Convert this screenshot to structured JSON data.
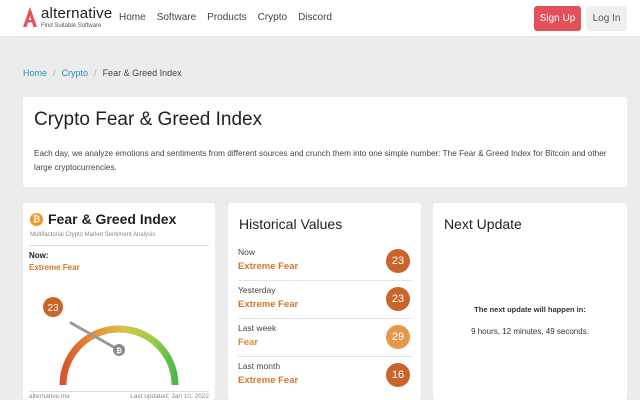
{
  "nav": {
    "logo": {
      "name": "alternative",
      "tagline": "Find Suitable Software"
    },
    "menu": [
      "Home",
      "Software",
      "Products",
      "Crypto",
      "Discord"
    ],
    "signup": "Sign Up",
    "login": "Log In",
    "accent": "#e4505a"
  },
  "breadcrumb": {
    "home": "Home",
    "crypto": "Crypto",
    "current": "Fear & Greed Index",
    "sep": "/"
  },
  "intro": {
    "title": "Crypto Fear & Greed Index",
    "description": "Each day, we analyze emotions and sentiments from different sources and crunch them into one simple number: The Fear & Greed Index for Bitcoin and other large cryptocurrencies."
  },
  "gauge_card": {
    "title": "Fear & Greed Index",
    "subtitle": "Multifactorial Crypto Market Sentiment Analysis",
    "now_label": "Now:",
    "classification": "Extreme Fear",
    "value": "23",
    "coin_symbol": "₿",
    "footer_left": "alternative.me",
    "footer_right": "Last updated: Jan 10, 2022",
    "classification_color": "#d9742a"
  },
  "historical": {
    "title": "Historical Values",
    "rows": [
      {
        "label": "Now",
        "classification": "Extreme Fear",
        "value": "23",
        "color": "#d9742a",
        "circle": "#c9642a"
      },
      {
        "label": "Yesterday",
        "classification": "Extreme Fear",
        "value": "23",
        "color": "#d9742a",
        "circle": "#c9642a"
      },
      {
        "label": "Last week",
        "classification": "Fear",
        "value": "29",
        "color": "#e08a2e",
        "circle": "#e3984a"
      },
      {
        "label": "Last month",
        "classification": "Extreme Fear",
        "value": "16",
        "color": "#d9742a",
        "circle": "#c9642a"
      }
    ]
  },
  "next_update": {
    "title": "Next Update",
    "message": "The next update will happen in:",
    "countdown": "9 hours, 12 minutes, 49 seconds."
  }
}
